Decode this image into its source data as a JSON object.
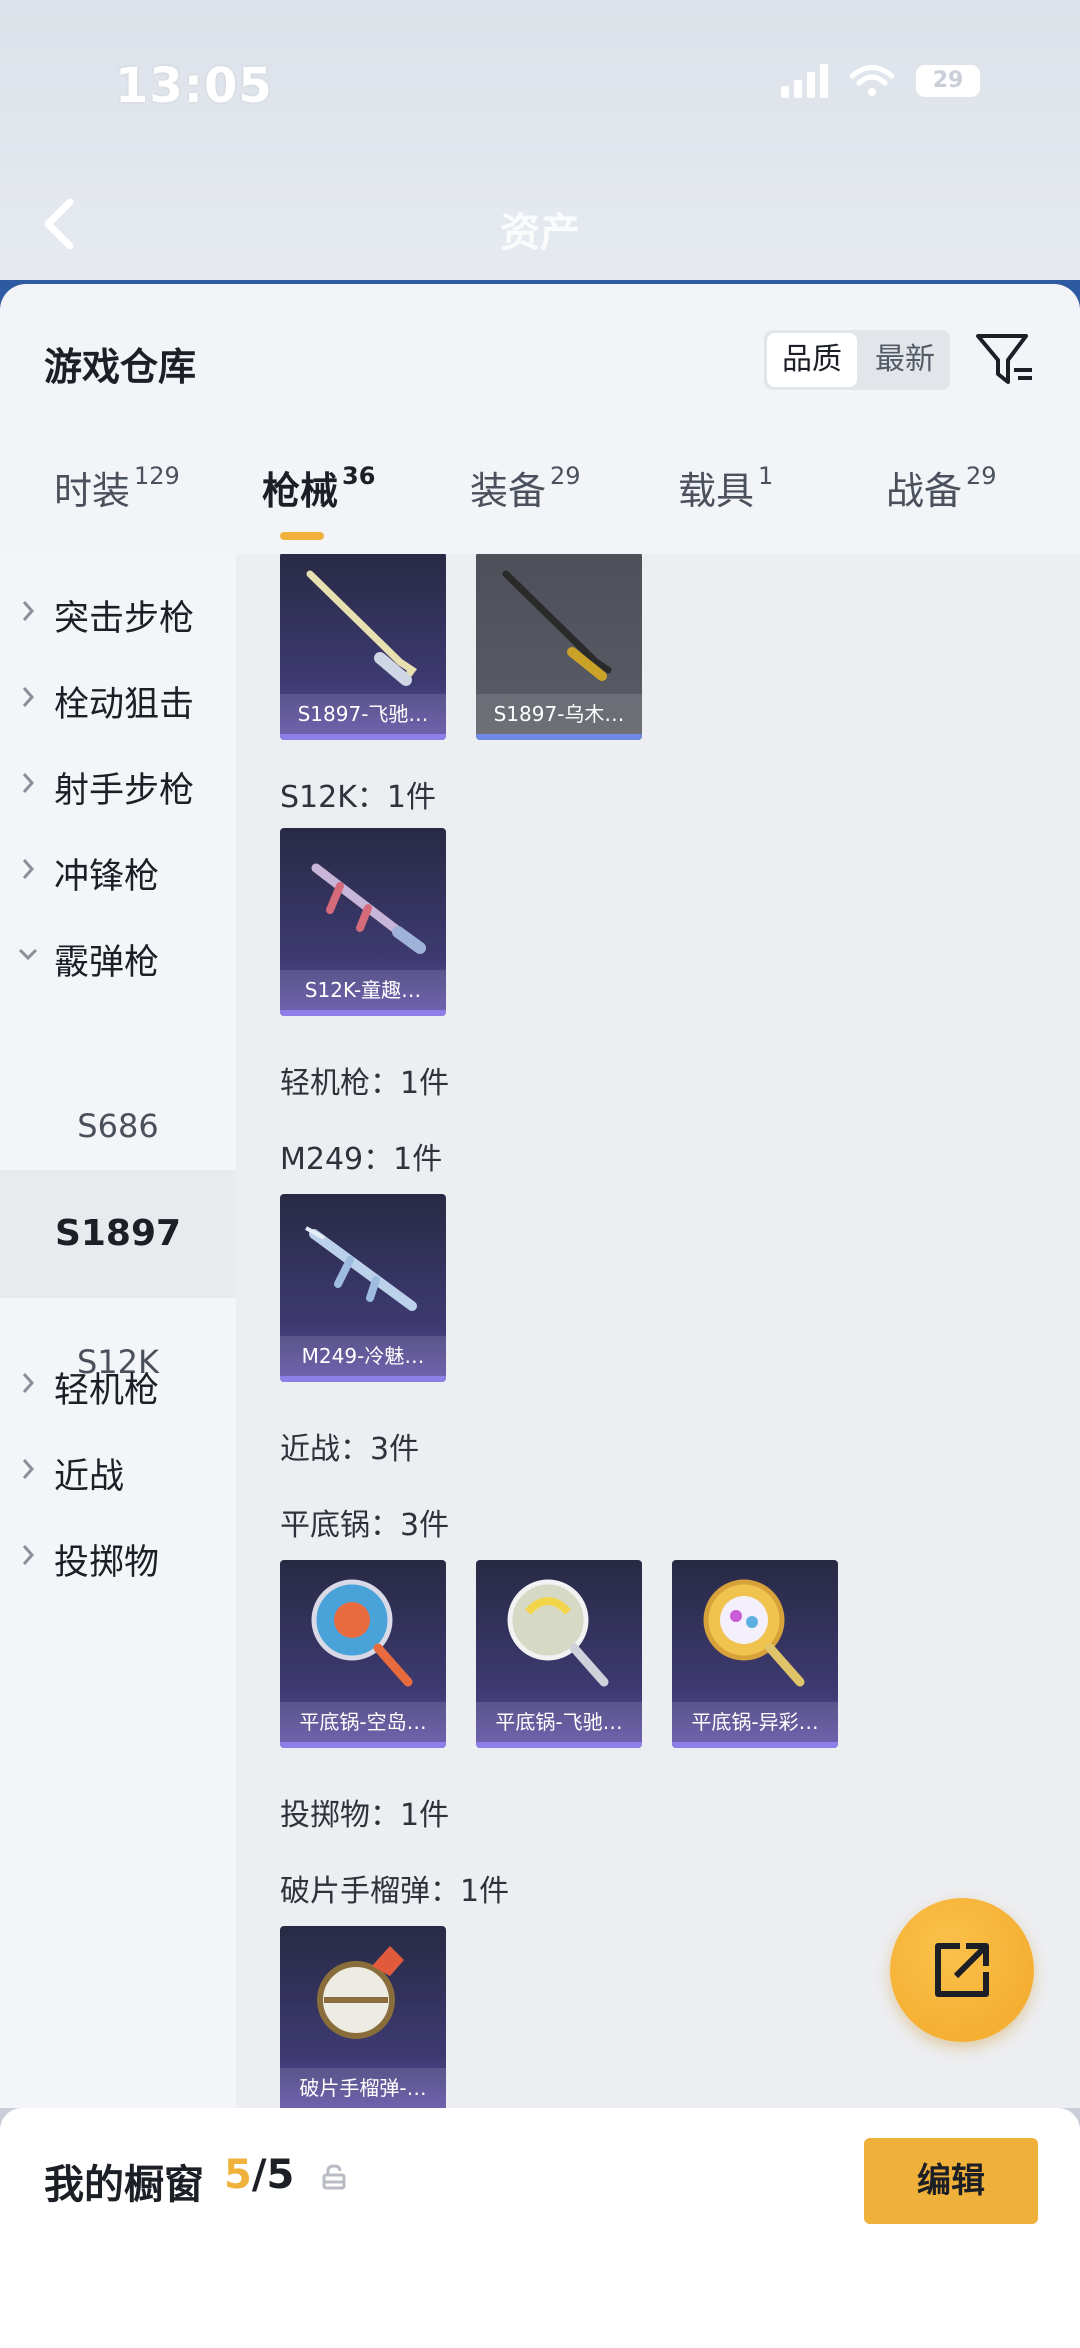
{
  "status": {
    "time": "13:05",
    "battery": "29"
  },
  "header": {
    "title": "资产"
  },
  "warehouse": {
    "title": "游戏仓库",
    "sort_options": [
      "品质",
      "最新"
    ],
    "sort_selected": "品质"
  },
  "tabs": [
    {
      "label": "时装",
      "count": "129"
    },
    {
      "label": "枪械",
      "count": "36"
    },
    {
      "label": "装备",
      "count": "29"
    },
    {
      "label": "载具",
      "count": "1"
    },
    {
      "label": "战备",
      "count": "29"
    }
  ],
  "active_tab": "枪械",
  "categories": [
    "突击步枪",
    "栓动狙击",
    "射手步枪",
    "冲锋枪",
    "霰弹枪",
    "轻机枪",
    "近战",
    "投掷物"
  ],
  "subcategories": [
    "S686",
    "S1897",
    "S12K"
  ],
  "selected_subcategory": "S1897",
  "content": {
    "row1_items": [
      "S1897-飞驰…",
      "S1897-乌木…"
    ],
    "s12k_label": "S12K：1件",
    "s12k_items": [
      "S12K-童趣…"
    ],
    "lmg_label": "轻机枪：1件",
    "m249_label": "M249：1件",
    "m249_items": [
      "M249-冷魅…"
    ],
    "melee_label": "近战：3件",
    "pan_label": "平底锅：3件",
    "pan_items": [
      "平底锅-空岛…",
      "平底锅-飞驰…",
      "平底锅-异彩…"
    ],
    "throw_label": "投掷物：1件",
    "frag_label": "破片手榴弹：1件",
    "frag_items": [
      "破片手榴弹-…"
    ]
  },
  "showcase": {
    "title": "我的橱窗",
    "current": "5",
    "total": "/5",
    "edit_label": "编辑"
  },
  "colors": {
    "accent": "#f0b13b",
    "item_bg": "#3e3a72",
    "item_bar": "#8e7fe8"
  }
}
